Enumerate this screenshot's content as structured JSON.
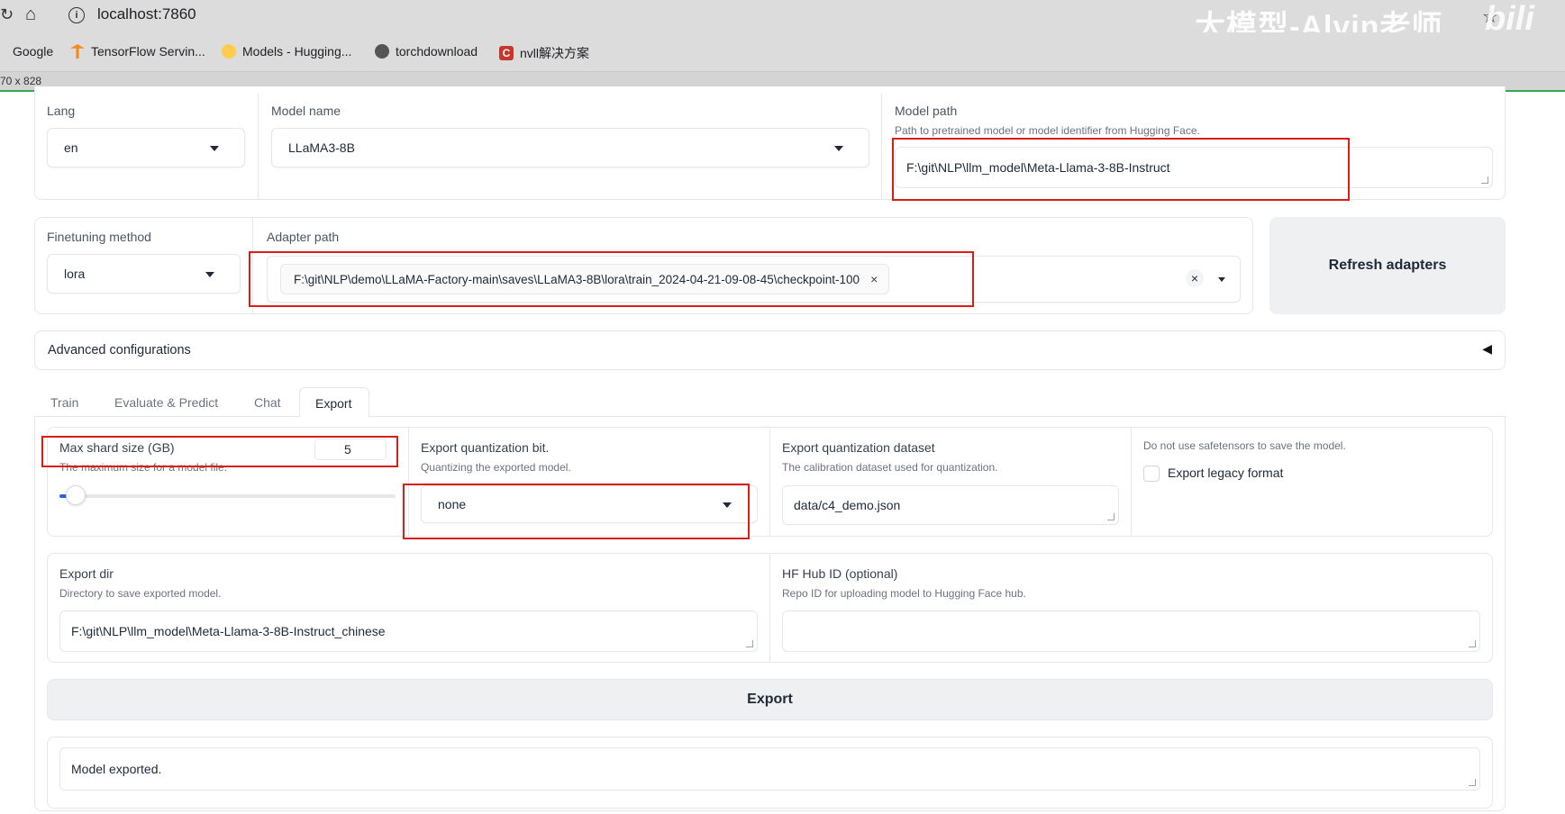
{
  "browser": {
    "url": "localhost:7860",
    "watermark": "大模型-Alvin老师",
    "bili": "bili",
    "bookmarks": [
      "Google",
      "TensorFlow Servin...",
      "Models - Hugging...",
      "torchdownload",
      "nvll解决方案"
    ],
    "viewport_size": "70 x 828"
  },
  "top": {
    "lang_label": "Lang",
    "lang_value": "en",
    "model_name_label": "Model name",
    "model_name_value": "LLaMA3-8B",
    "model_path_label": "Model path",
    "model_path_info": "Path to pretrained model or model identifier from Hugging Face.",
    "model_path_value": "F:\\git\\NLP\\llm_model\\Meta-Llama-3-8B-Instruct"
  },
  "adapter": {
    "finetuning_label": "Finetuning method",
    "finetuning_value": "lora",
    "adapter_path_label": "Adapter path",
    "adapter_path_value": "F:\\git\\NLP\\demo\\LLaMA-Factory-main\\saves\\LLaMA3-8B\\lora\\train_2024-04-21-09-08-45\\checkpoint-100",
    "chip_close": "×",
    "clear_glyph": "×",
    "refresh_label": "Refresh adapters"
  },
  "advanced": {
    "label": "Advanced configurations",
    "toggle": "◀"
  },
  "tabs": [
    "Train",
    "Evaluate & Predict",
    "Chat",
    "Export"
  ],
  "export": {
    "shard_label": "Max shard size (GB)",
    "shard_info": "The maximum size for a model file.",
    "shard_value": "5",
    "shard_fraction": 0.02,
    "quant_bit_label": "Export quantization bit.",
    "quant_bit_info": "Quantizing the exported model.",
    "quant_bit_value": "none",
    "quant_dataset_label": "Export quantization dataset",
    "quant_dataset_info": "The calibration dataset used for quantization.",
    "quant_dataset_value": "data/c4_demo.json",
    "legacy_info": "Do not use safetensors to save the model.",
    "legacy_label": "Export legacy format",
    "export_dir_label": "Export dir",
    "export_dir_info": "Directory to save exported model.",
    "export_dir_value": "F:\\git\\NLP\\llm_model\\Meta-Llama-3-8B-Instruct_chinese",
    "hub_label": "HF Hub ID (optional)",
    "hub_info": "Repo ID for uploading model to Hugging Face hub.",
    "hub_value": "",
    "export_button": "Export",
    "status_value": "Model exported."
  },
  "colors": {
    "highlight": "#d91e18",
    "slider_accent": "#2563eb",
    "button_bg": "#eff0f2"
  }
}
